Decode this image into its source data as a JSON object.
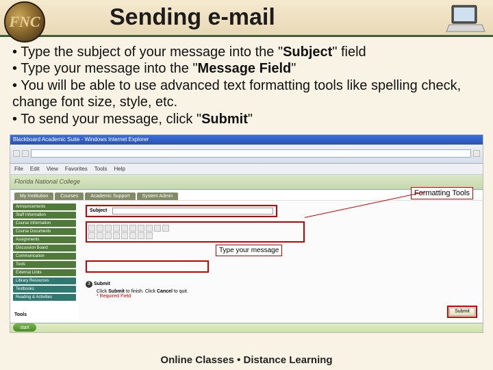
{
  "header": {
    "logo_text": "FNC",
    "title": "Sending e-mail"
  },
  "bullets": {
    "b1_pre": "• Type the subject of your message into the \"",
    "b1_bold": "Subject",
    "b1_post": "\" field",
    "b2_pre": "• Type your message into the \"",
    "b2_bold": "Message Field",
    "b2_post": "\"",
    "b3": "• You will be able to use advanced text formatting tools like spelling check, change font size, style, etc.",
    "b4_pre": "• To send your message, click \"",
    "b4_bold": "Submit",
    "b4_post": "\""
  },
  "screenshot": {
    "ie_title": "Blackboard Academic Suite - Windows Internet Explorer",
    "menubar": [
      "File",
      "Edit",
      "View",
      "Favorites",
      "Tools",
      "Help"
    ],
    "bb_brand": "Florida National College",
    "tabs": [
      "My Institution",
      "Courses",
      "Academic Support",
      "System Admin"
    ],
    "sidebar": [
      "Announcements",
      "Staff Information",
      "Course Information",
      "Course Documents",
      "Assignments",
      "Discussion Board",
      "Communication",
      "Tools",
      "External Links",
      "Library Resources",
      "Textbooks",
      "Reading & Activities"
    ],
    "subject_label": "Subject",
    "submit_num": "3",
    "submit_heading": "Submit",
    "submit_text_pre": "Click ",
    "submit_text_b1": "Submit",
    "submit_text_mid": " to finish. Click ",
    "submit_text_b2": "Cancel",
    "submit_text_post": " to quit.",
    "required": "Required Field",
    "submit_btn": "Submit",
    "start": "start",
    "tools_label": "Tools"
  },
  "callouts": {
    "formatting": "Formatting Tools",
    "type_msg": "Type your message"
  },
  "footer": "Online Classes  •  Distance Learning"
}
